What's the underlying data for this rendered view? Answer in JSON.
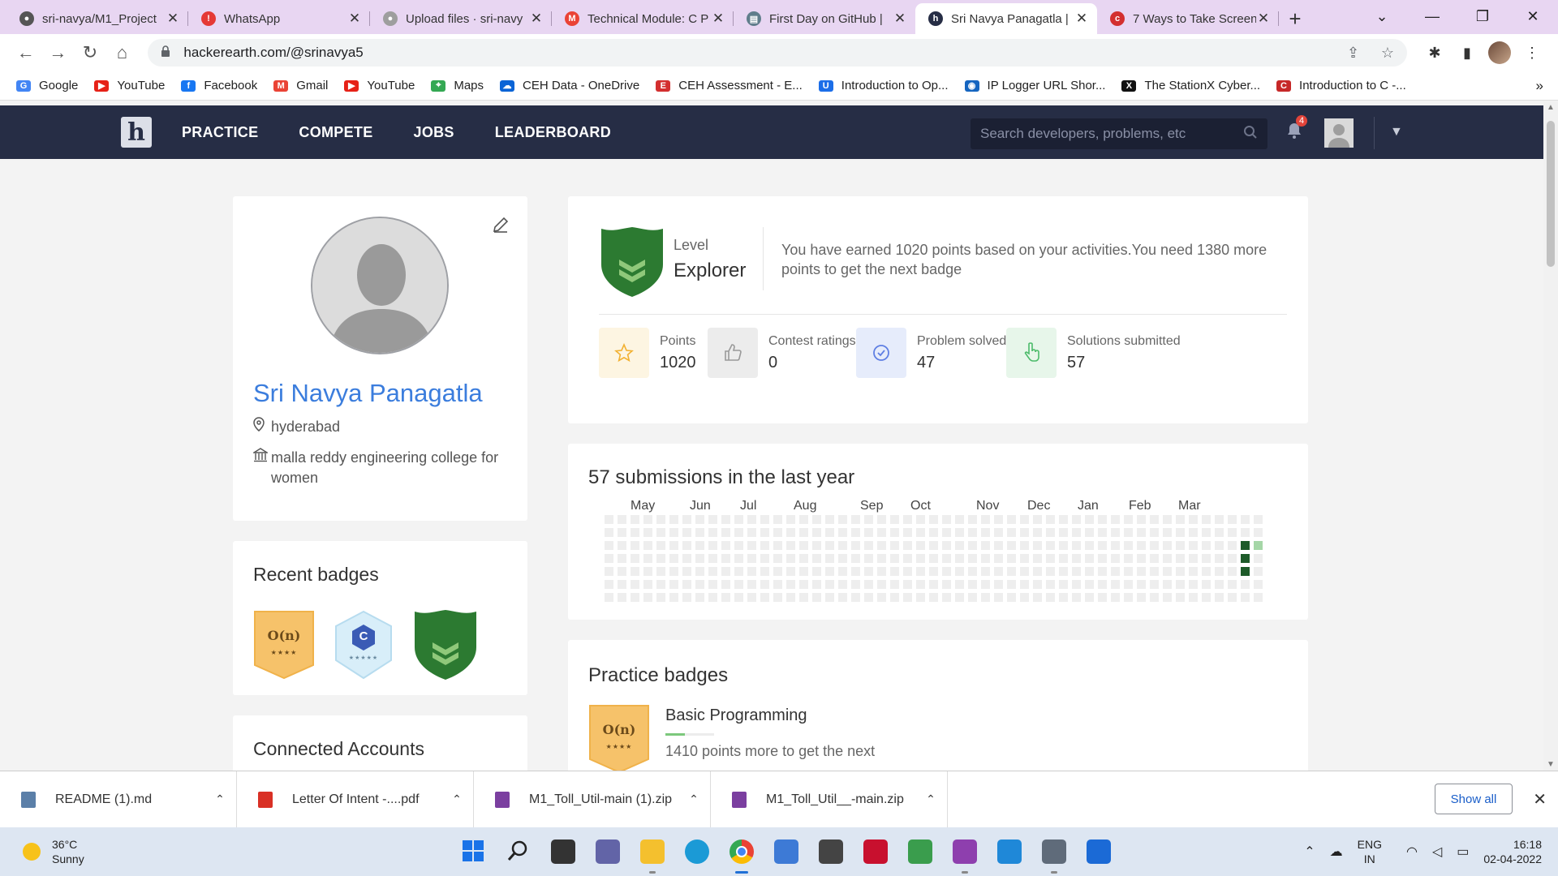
{
  "browser": {
    "tabs": [
      {
        "title": "sri-navya/M1_Project",
        "icon": "github-icon",
        "color": "#555555",
        "glyph": "●"
      },
      {
        "title": "WhatsApp",
        "icon": "whatsapp-icon",
        "color": "#e53935",
        "glyph": "!"
      },
      {
        "title": "Upload files · sri-navy",
        "icon": "github-icon",
        "color": "#9e9e9e",
        "glyph": "●"
      },
      {
        "title": "Technical Module: C P",
        "icon": "gmail-icon",
        "color": "#ea4335",
        "glyph": "M"
      },
      {
        "title": "First Day on GitHub |",
        "icon": "website-icon",
        "color": "#607d8b",
        "glyph": "▤"
      },
      {
        "title": "Sri Navya Panagatla |",
        "icon": "hackerearth-icon",
        "color": "#262d45",
        "glyph": "h"
      },
      {
        "title": "7 Ways to Take Screen",
        "icon": "cnet-icon",
        "color": "#d32f2f",
        "glyph": "c"
      }
    ],
    "active_tab": 5,
    "url": "hackerearth.com/@srinavya5",
    "bookmarks": [
      {
        "label": "Google",
        "icon": "google-icon",
        "color": "#4285f4",
        "glyph": "G"
      },
      {
        "label": "YouTube",
        "icon": "youtube-icon",
        "color": "#e62117",
        "glyph": "▶"
      },
      {
        "label": "Facebook",
        "icon": "facebook-icon",
        "color": "#1877f2",
        "glyph": "f"
      },
      {
        "label": "Gmail",
        "icon": "gmail-icon",
        "color": "#ea4335",
        "glyph": "M"
      },
      {
        "label": "YouTube",
        "icon": "youtube-icon",
        "color": "#e62117",
        "glyph": "▶"
      },
      {
        "label": "Maps",
        "icon": "maps-icon",
        "color": "#34a853",
        "glyph": "⌖"
      },
      {
        "label": "CEH Data - OneDrive",
        "icon": "onedrive-icon",
        "color": "#0a64d6",
        "glyph": "☁"
      },
      {
        "label": "CEH Assessment - E...",
        "icon": "eccouncil-icon",
        "color": "#d32f2f",
        "glyph": "E"
      },
      {
        "label": "Introduction to Op...",
        "icon": "udemy-icon",
        "color": "#1c6ee8",
        "glyph": "U"
      },
      {
        "label": "IP Logger URL Shor...",
        "icon": "iplogger-icon",
        "color": "#1565c0",
        "glyph": "◉"
      },
      {
        "label": "The StationX Cyber...",
        "icon": "stationx-icon",
        "color": "#111111",
        "glyph": "X"
      },
      {
        "label": "Introduction to C -...",
        "icon": "cpp-icon",
        "color": "#c62828",
        "glyph": "C"
      }
    ]
  },
  "site": {
    "menu": [
      "PRACTICE",
      "COMPETE",
      "JOBS",
      "LEADERBOARD"
    ],
    "search_placeholder": "Search developers, problems, etc",
    "notification_count": "4"
  },
  "profile": {
    "name": "Sri Navya Panagatla",
    "location": "hyderabad",
    "college": "malla reddy engineering college for women"
  },
  "recent_badges": {
    "title": "Recent badges",
    "items": [
      {
        "name": "On-badge",
        "text": "O(n)",
        "stars": "★★★★"
      },
      {
        "name": "C-badge",
        "text": "C",
        "stars": "★★★★★"
      },
      {
        "name": "explorer-badge",
        "text": "",
        "stars": ""
      }
    ]
  },
  "connected_accounts": {
    "title": "Connected Accounts"
  },
  "level": {
    "label": "Level",
    "value": "Explorer",
    "description": "You have earned 1020 points based on your activities.You need 1380 more points to get the next badge"
  },
  "stats": [
    {
      "label": "Points",
      "value": "1020",
      "icon": "star-icon",
      "bg": "#fdf5e2",
      "color": "#f2b132"
    },
    {
      "label": "Contest ratings",
      "value": "0",
      "icon": "thumbs-up-icon",
      "bg": "#ececec",
      "color": "#999999"
    },
    {
      "label": "Problem solved",
      "value": "47",
      "icon": "check-circle-icon",
      "bg": "#e6ecfb",
      "color": "#5f7fe3"
    },
    {
      "label": "Solutions submitted",
      "value": "57",
      "icon": "pointer-hand-icon",
      "bg": "#e7f6ea",
      "color": "#4cbb6a"
    }
  ],
  "submissions": {
    "title": "57 submissions in the last year",
    "months": [
      "May",
      "Jun",
      "Jul",
      "Aug",
      "Sep",
      "Oct",
      "Nov",
      "Dec",
      "Jan",
      "Feb",
      "Mar"
    ],
    "weeks": 51,
    "days": 7,
    "active_cells": [
      {
        "week": 49,
        "day": 2,
        "level": 3
      },
      {
        "week": 49,
        "day": 3,
        "level": 3
      },
      {
        "week": 49,
        "day": 4,
        "level": 3
      },
      {
        "week": 50,
        "day": 2,
        "level": 1
      }
    ],
    "colors": {
      "empty": "#eeeeee",
      "light": "#a5d6a7",
      "dark": "#1e5b2a"
    }
  },
  "practice_badges": {
    "title": "Practice badges",
    "items": [
      {
        "name": "Basic Programming",
        "text": "O(n)",
        "stars": "★★★★",
        "progress": 0.4,
        "note": "1410 points more to get the next"
      }
    ]
  },
  "downloads": {
    "items": [
      {
        "name": "README (1).md",
        "icon": "markdown-file-icon",
        "color": "#5b7fa8"
      },
      {
        "name": "Letter Of Intent -....pdf",
        "icon": "pdf-file-icon",
        "color": "#d93025"
      },
      {
        "name": "M1_Toll_Util-main (1).zip",
        "icon": "winrar-archive-icon",
        "color": "#7b3fa0"
      },
      {
        "name": "M1_Toll_Util__-main.zip",
        "icon": "winrar-archive-icon",
        "color": "#7b3fa0"
      }
    ],
    "show_all": "Show all"
  },
  "taskbar": {
    "temperature": "36°C",
    "weather": "Sunny",
    "apps": [
      {
        "name": "windows-start-icon",
        "color": "#1a73e8",
        "running": false,
        "active": false
      },
      {
        "name": "search-icon",
        "color": "#222222",
        "running": false,
        "active": false
      },
      {
        "name": "task-view-icon",
        "color": "#333333",
        "running": false,
        "active": false
      },
      {
        "name": "teams-chat-icon",
        "color": "#6264a7",
        "running": false,
        "active": false
      },
      {
        "name": "file-explorer-icon",
        "color": "#f4c02e",
        "running": true,
        "active": false
      },
      {
        "name": "edge-icon",
        "color": "#1b9ad6",
        "running": false,
        "active": false
      },
      {
        "name": "chrome-icon",
        "color": "#ea4335",
        "running": true,
        "active": true
      },
      {
        "name": "ms-store-icon",
        "color": "#3d7ad6",
        "running": false,
        "active": false
      },
      {
        "name": "dell-icon",
        "color": "#444444",
        "running": false,
        "active": false
      },
      {
        "name": "mcafee-icon",
        "color": "#c8102e",
        "running": false,
        "active": false
      },
      {
        "name": "git-icon",
        "color": "#3a9d4d",
        "running": false,
        "active": false
      },
      {
        "name": "winrar-icon",
        "color": "#8e3fae",
        "running": true,
        "active": false
      },
      {
        "name": "vscode-icon",
        "color": "#1f88d8",
        "running": false,
        "active": false
      },
      {
        "name": "settings-icon",
        "color": "#5f6b7a",
        "running": true,
        "active": false
      },
      {
        "name": "quick-assist-icon",
        "color": "#1b6ad6",
        "running": false,
        "active": false
      }
    ],
    "lang_top": "ENG",
    "lang_bottom": "IN",
    "time": "16:18",
    "date": "02-04-2022"
  }
}
